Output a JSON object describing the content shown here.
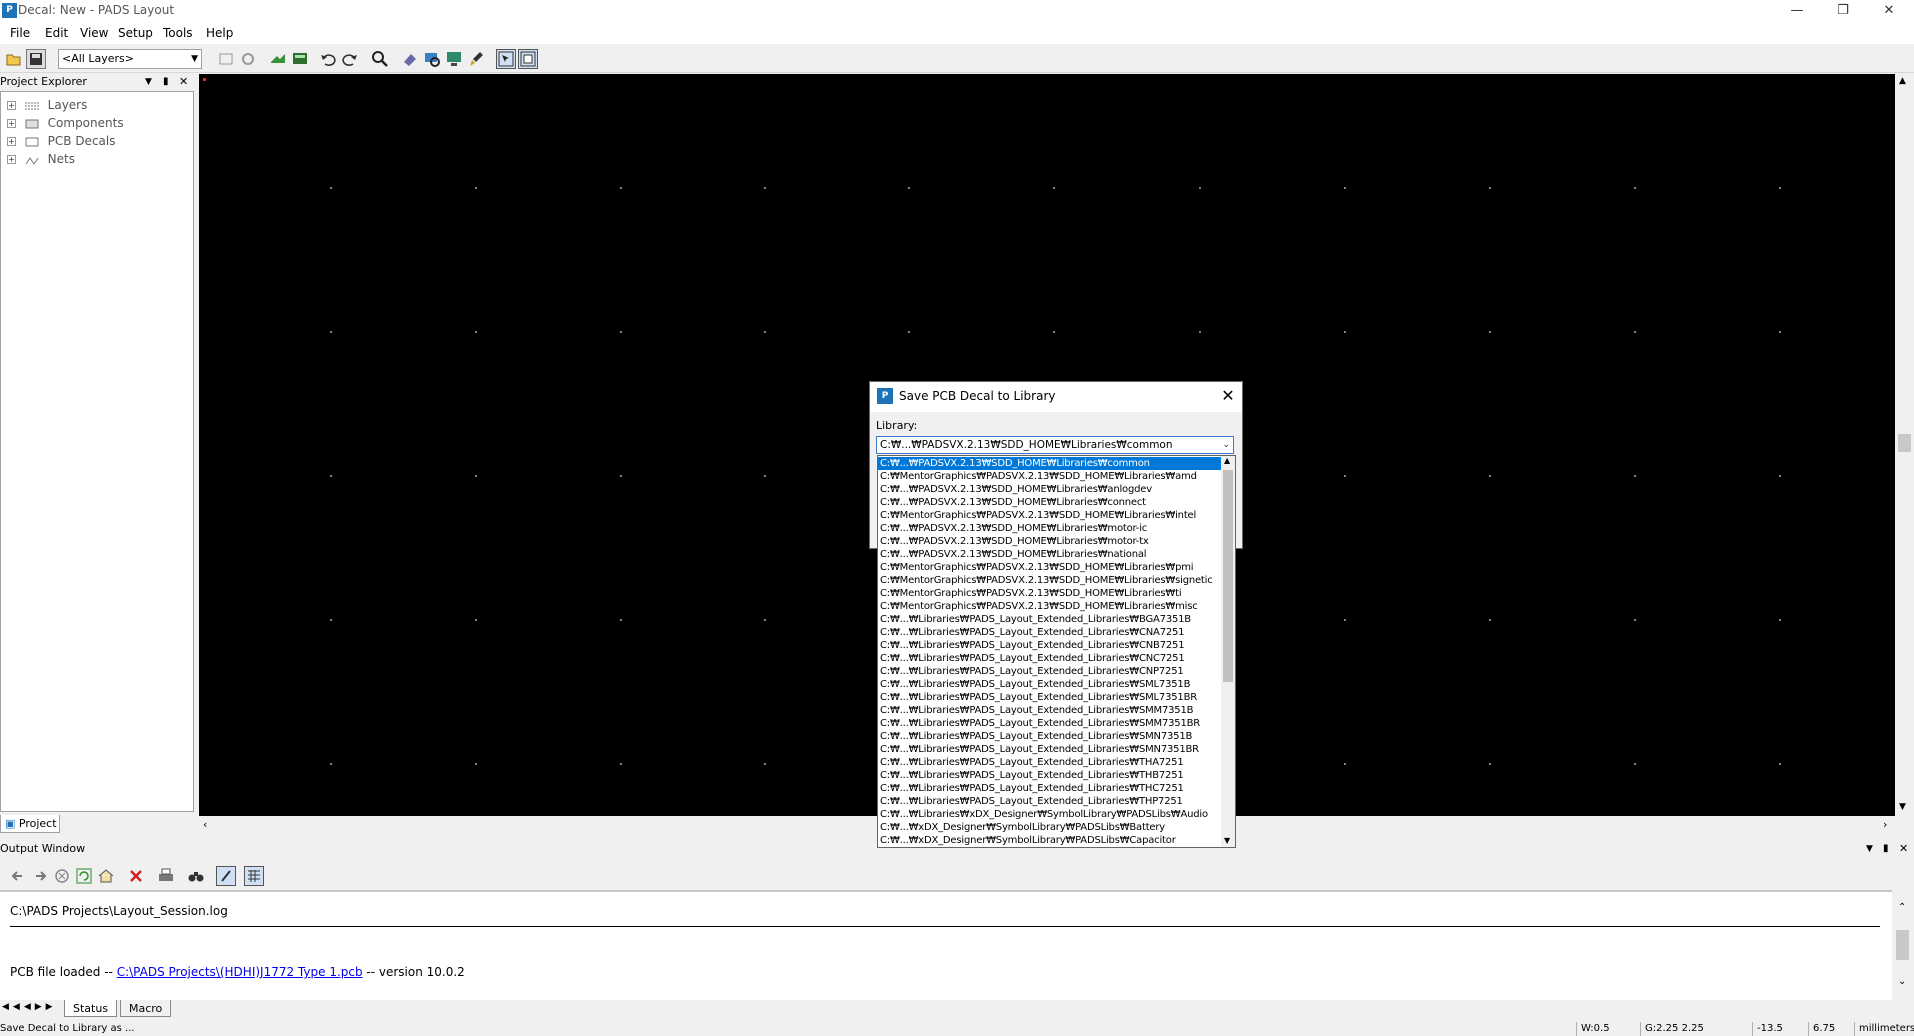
{
  "window": {
    "title": "Decal: New - PADS Layout",
    "minimize_icon": "minimize-icon",
    "restore_icon": "restore-icon",
    "close_icon": "close-icon"
  },
  "menu": [
    "File",
    "Edit",
    "View",
    "Setup",
    "Tools",
    "Help"
  ],
  "toolbar": {
    "layer_select": "<All Layers>"
  },
  "project_explorer": {
    "title": "Project Explorer",
    "items": [
      "Layers",
      "Components",
      "PCB Decals",
      "Nets"
    ],
    "tab": "Project"
  },
  "output_window": {
    "title": "Output Window",
    "log_file": "C:\\PADS Projects\\Layout_Session.log",
    "line_prefix": "PCB file loaded -- ",
    "line_link": "C:\\PADS Projects\\(HDHI)J1772 Type 1.pcb",
    "line_suffix": " -- version 10.0.2",
    "tabs": [
      "Status",
      "Macro"
    ]
  },
  "dialog": {
    "title": "Save PCB Decal to Library",
    "library_label": "Library:",
    "selected_library": "C:₩...₩PADSVX.2.13₩SDD_HOME₩Libraries₩common",
    "libraries": [
      "C:₩...₩PADSVX.2.13₩SDD_HOME₩Libraries₩common",
      "C:₩MentorGraphics₩PADSVX.2.13₩SDD_HOME₩Libraries₩amd",
      "C:₩...₩PADSVX.2.13₩SDD_HOME₩Libraries₩anlogdev",
      "C:₩...₩PADSVX.2.13₩SDD_HOME₩Libraries₩connect",
      "C:₩MentorGraphics₩PADSVX.2.13₩SDD_HOME₩Libraries₩intel",
      "C:₩...₩PADSVX.2.13₩SDD_HOME₩Libraries₩motor-ic",
      "C:₩...₩PADSVX.2.13₩SDD_HOME₩Libraries₩motor-tx",
      "C:₩...₩PADSVX.2.13₩SDD_HOME₩Libraries₩national",
      "C:₩MentorGraphics₩PADSVX.2.13₩SDD_HOME₩Libraries₩pmi",
      "C:₩MentorGraphics₩PADSVX.2.13₩SDD_HOME₩Libraries₩signetic",
      "C:₩MentorGraphics₩PADSVX.2.13₩SDD_HOME₩Libraries₩ti",
      "C:₩MentorGraphics₩PADSVX.2.13₩SDD_HOME₩Libraries₩misc",
      "C:₩...₩Libraries₩PADS_Layout_Extended_Libraries₩BGA7351B",
      "C:₩...₩Libraries₩PADS_Layout_Extended_Libraries₩CNA7251",
      "C:₩...₩Libraries₩PADS_Layout_Extended_Libraries₩CNB7251",
      "C:₩...₩Libraries₩PADS_Layout_Extended_Libraries₩CNC7251",
      "C:₩...₩Libraries₩PADS_Layout_Extended_Libraries₩CNP7251",
      "C:₩...₩Libraries₩PADS_Layout_Extended_Libraries₩SML7351B",
      "C:₩...₩Libraries₩PADS_Layout_Extended_Libraries₩SML7351BR",
      "C:₩...₩Libraries₩PADS_Layout_Extended_Libraries₩SMM7351B",
      "C:₩...₩Libraries₩PADS_Layout_Extended_Libraries₩SMM7351BR",
      "C:₩...₩Libraries₩PADS_Layout_Extended_Libraries₩SMN7351B",
      "C:₩...₩Libraries₩PADS_Layout_Extended_Libraries₩SMN7351BR",
      "C:₩...₩Libraries₩PADS_Layout_Extended_Libraries₩THA7251",
      "C:₩...₩Libraries₩PADS_Layout_Extended_Libraries₩THB7251",
      "C:₩...₩Libraries₩PADS_Layout_Extended_Libraries₩THC7251",
      "C:₩...₩Libraries₩PADS_Layout_Extended_Libraries₩THP7251",
      "C:₩...₩Libraries₩xDX_Designer₩SymbolLibrary₩PADSLibs₩Audio",
      "C:₩...₩xDX_Designer₩SymbolLibrary₩PADSLibs₩Battery",
      "C:₩...₩xDX_Designer₩SymbolLibrary₩PADSLibs₩Capacitor"
    ]
  },
  "status_bar": {
    "message": "Save Decal to Library as ...",
    "width": "W:0.5",
    "grid": "G:2.25 2.25",
    "x": "-13.5",
    "y": "6.75",
    "units": "millimeters"
  },
  "colors": {
    "canvas": "#000000",
    "selection": "#0078d7",
    "link": "#0000ee"
  }
}
